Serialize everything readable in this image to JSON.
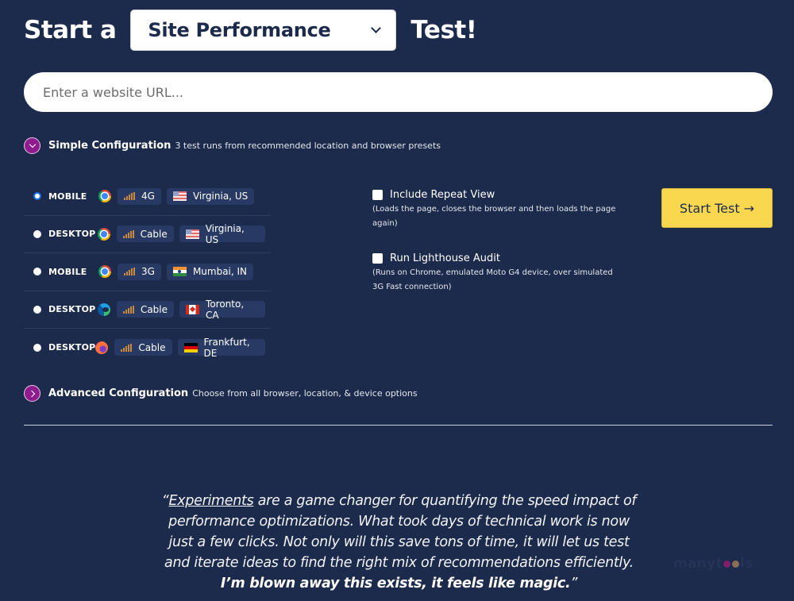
{
  "header": {
    "prefix": "Start a",
    "test_type": "Site Performance",
    "suffix": "Test!"
  },
  "url_input": {
    "placeholder": "Enter a website URL...",
    "value": ""
  },
  "simple_config": {
    "title": "Simple Configuration",
    "description": "3 test runs from recommended location and browser presets",
    "expanded": true
  },
  "presets": [
    {
      "device": "MOBILE",
      "browser": "chrome",
      "connection": "4G",
      "location": "Virginia, US",
      "flag": "us",
      "selected": true
    },
    {
      "device": "DESKTOP",
      "browser": "chrome",
      "connection": "Cable",
      "location": "Virginia, US",
      "flag": "us",
      "selected": false
    },
    {
      "device": "MOBILE",
      "browser": "chrome",
      "connection": "3G",
      "location": "Mumbai, IN",
      "flag": "in",
      "selected": false
    },
    {
      "device": "DESKTOP",
      "browser": "edge",
      "connection": "Cable",
      "location": "Toronto, CA",
      "flag": "ca",
      "selected": false
    },
    {
      "device": "DESKTOP",
      "browser": "firefox",
      "connection": "Cable",
      "location": "Frankfurt, DE",
      "flag": "de",
      "selected": false
    }
  ],
  "options": {
    "repeat_view": {
      "label": "Include Repeat View",
      "note": "(Loads the page, closes the browser and then loads the page again)",
      "checked": false
    },
    "lighthouse": {
      "label": "Run Lighthouse Audit",
      "note": "(Runs on Chrome, emulated Moto G4 device, over simulated 3G Fast connection)",
      "checked": false
    }
  },
  "start_button": {
    "label": "Start Test →"
  },
  "advanced_config": {
    "title": "Advanced Configuration",
    "description": "Choose from all browser, location, & device options",
    "expanded": false
  },
  "testimonial": {
    "open_quote": "“",
    "link_text": "Experiments",
    "body": " are a game changer for quantifying the speed impact of performance optimizations. What took days of technical work is now just a few clicks. Not only will this save tons of time, it will let us test and iterate ideas to find the right mix of recommendations efficiently. ",
    "emphasis": "I’m blown away this exists, it feels like magic.",
    "close_quote": "”"
  },
  "watermark": {
    "text_before": "manyt",
    "text_after": "ls",
    "colors": [
      "#8e1c6e",
      "#9a7a5a"
    ]
  },
  "colors": {
    "background": "#1c2a4b",
    "accent": "#8e1c8e",
    "button": "#f9d84f"
  }
}
